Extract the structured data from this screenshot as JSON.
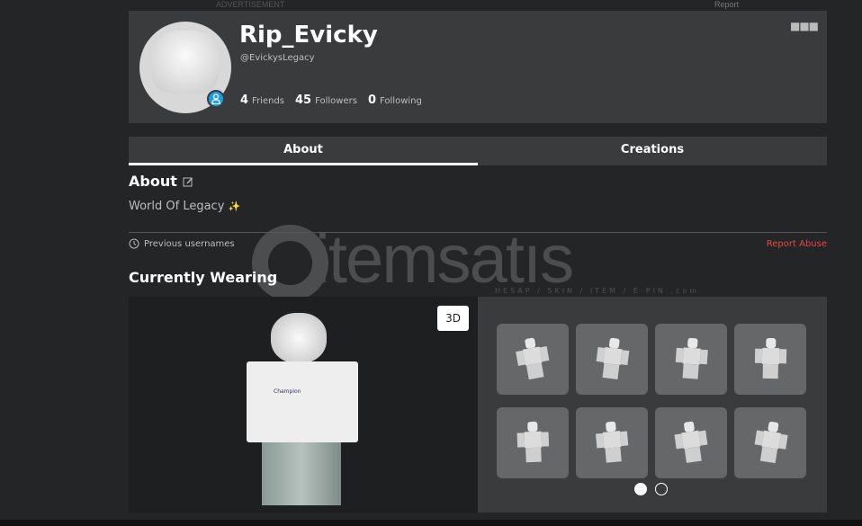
{
  "ad_label": "ADVERTISEMENT",
  "report_label": "Report",
  "profile": {
    "display_name": "Rip_Evicky",
    "username": "@EvickysLegacy",
    "stats": [
      {
        "count": "4",
        "label": "Friends"
      },
      {
        "count": "45",
        "label": "Followers"
      },
      {
        "count": "0",
        "label": "Following"
      }
    ],
    "more_icon": "ellipsis-icon",
    "badge_icon": "user-icon",
    "badge_color": "#1a9cf0"
  },
  "tabs": [
    {
      "label": "About",
      "active": true
    },
    {
      "label": "Creations",
      "active": false
    }
  ],
  "about": {
    "heading": "About",
    "bio": "World Of Legacy",
    "bio_emoji": "✨",
    "previous_usernames": "Previous usernames",
    "report_abuse": "Report Abuse",
    "report_color": "#e84545"
  },
  "wearing": {
    "heading": "Currently Wearing",
    "view_3d": "3D",
    "outfit_count": 8,
    "page": 1,
    "pages": 2
  },
  "watermark": {
    "text": "itemsatis",
    "sub": "HESAP / SKIN / ITEM / E-PIN .com"
  }
}
